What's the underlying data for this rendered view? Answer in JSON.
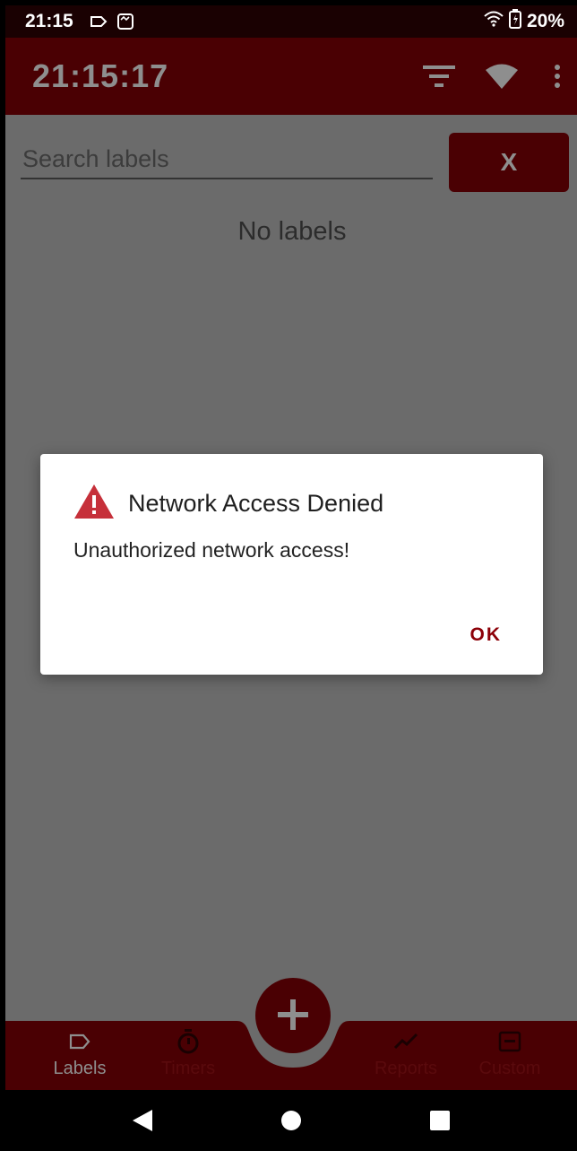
{
  "status_bar": {
    "time": "21:15",
    "battery": "20%"
  },
  "app_bar": {
    "title": "21:15:17",
    "icons": [
      "filter-icon",
      "wifi-icon",
      "more-vert-icon"
    ]
  },
  "search": {
    "placeholder": "Search labels",
    "value": "",
    "clear_label": "X"
  },
  "empty_state": "No labels",
  "dialog": {
    "title": "Network Access Denied",
    "message": "Unauthorized network access!",
    "ok_label": "OK",
    "icon": "warning-icon"
  },
  "bottom_nav": {
    "items": [
      {
        "label": "Labels",
        "icon": "label-icon",
        "active": true
      },
      {
        "label": "Timers",
        "icon": "timer-icon",
        "active": false
      },
      {
        "label": "Reports",
        "icon": "trending-icon",
        "active": false
      },
      {
        "label": "Custom",
        "icon": "custom-icon",
        "active": false
      }
    ],
    "fab_icon": "plus-icon"
  },
  "colors": {
    "primary": "#4a0003",
    "overlay": "#6b6b6b",
    "accent": "#8c0008",
    "warning": "#c6303a"
  }
}
